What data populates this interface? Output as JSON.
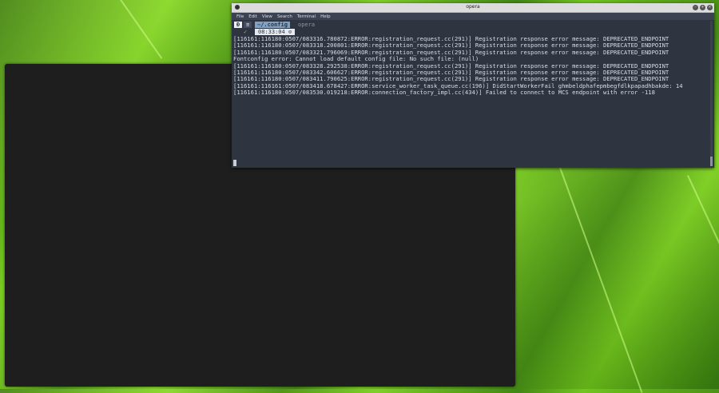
{
  "terminal": {
    "title": "opera",
    "menu": [
      "File",
      "Edit",
      "View",
      "Search",
      "Terminal",
      "Help"
    ],
    "prompt": {
      "badge": "Ð",
      "home_symbol": "≡",
      "path": "~/.config",
      "command": "opera"
    },
    "status": {
      "check": "✓",
      "time": "08:33:04 ⊙"
    },
    "output_lines": [
      "[116161:116180:0507/083316.780872:ERROR:registration_request.cc(291)] Registration response error message: DEPRECATED_ENDPOINT",
      "[116161:116180:0507/083318.200801:ERROR:registration_request.cc(291)] Registration response error message: DEPRECATED_ENDPOINT",
      "[116161:116180:0507/083321.796069:ERROR:registration_request.cc(291)] Registration response error message: DEPRECATED_ENDPOINT",
      "Fontconfig error: Cannot load default config file: No such file: (null)",
      "[116161:116180:0507/083328.292538:ERROR:registration_request.cc(291)] Registration response error message: DEPRECATED_ENDPOINT",
      "[116161:116180:0507/083342.606627:ERROR:registration_request.cc(291)] Registration response error message: DEPRECATED_ENDPOINT",
      "[116161:116180:0507/083411.790625:ERROR:registration_request.cc(291)] Registration response error message: DEPRECATED_ENDPOINT",
      "[116161:116161:0507/083418.678427:ERROR:service_worker_task_queue.cc(196)] DidStartWorkerFail ghmbeldphafepmbegfdlkpapadhbakde: 14",
      "[116161:116180:0507/083530.019218:ERROR:connection_factory_impl.cc(434)] Failed to connect to MCS endpoint with error -118"
    ]
  },
  "colors": {
    "terminal_bg": "#2e3440",
    "dark_window_bg": "#1e1e1e",
    "wallpaper_green": "#6fc41c"
  }
}
